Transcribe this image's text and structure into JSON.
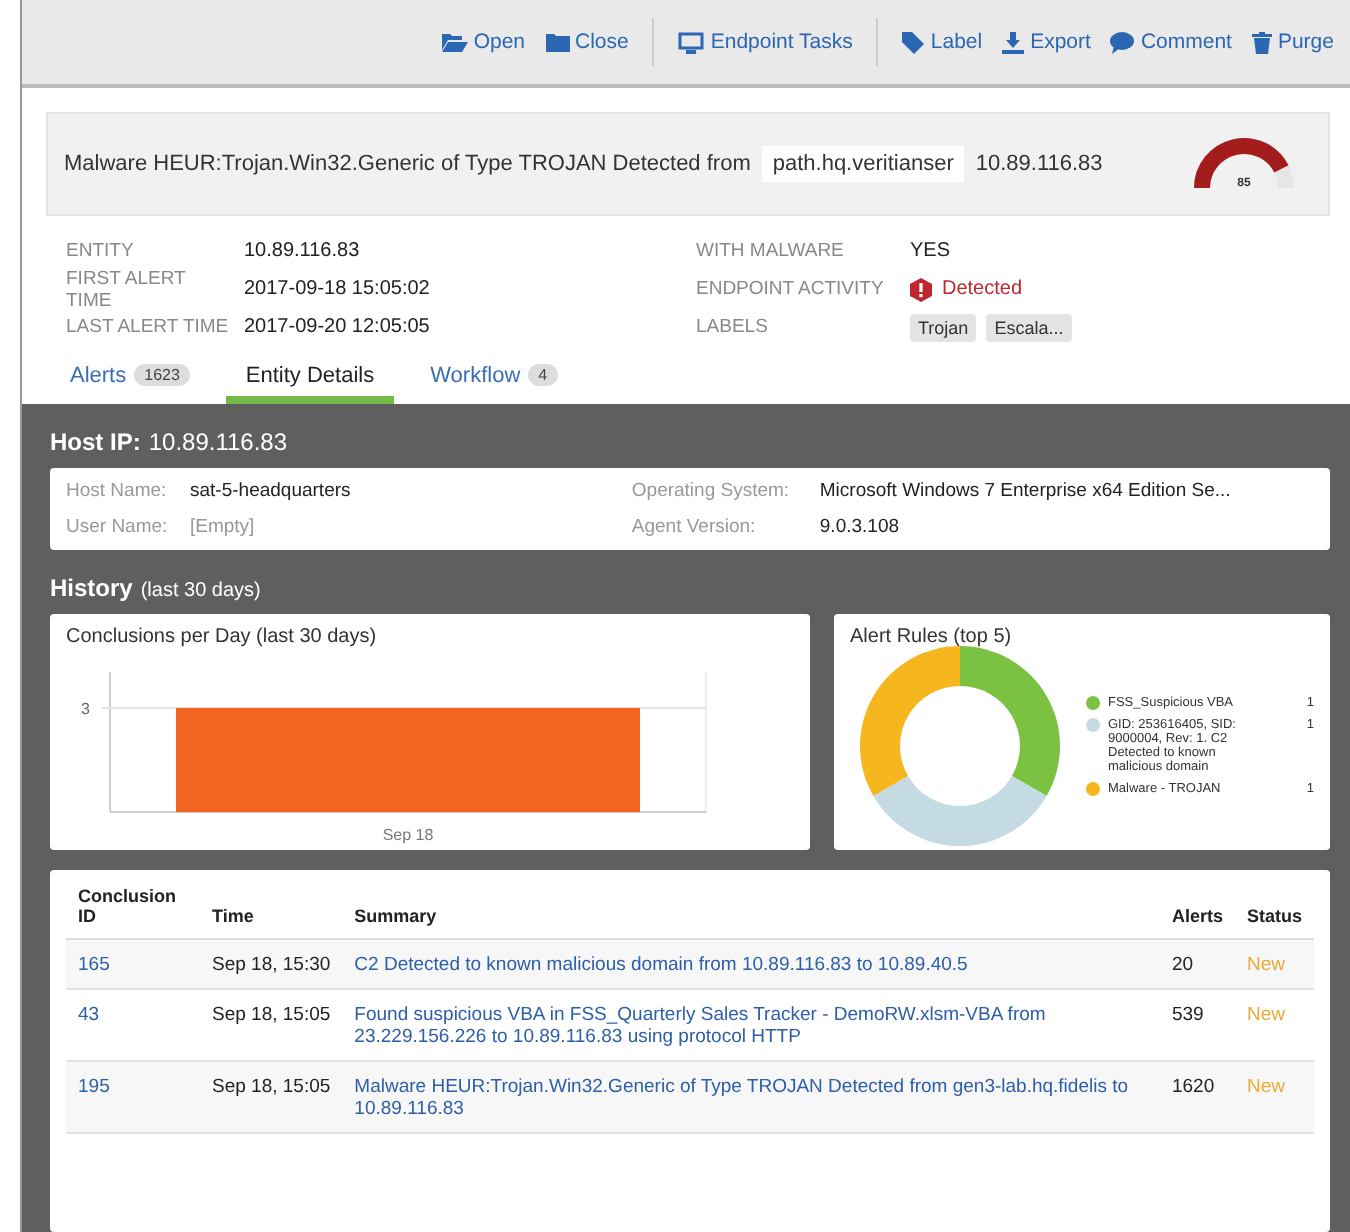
{
  "toolbar": {
    "buttons": [
      {
        "label": "Open"
      },
      {
        "label": "Close"
      },
      {
        "label": "Endpoint Tasks"
      },
      {
        "label": "Label"
      },
      {
        "label": "Export"
      },
      {
        "label": "Comment"
      },
      {
        "label": "Purge"
      }
    ]
  },
  "alert": {
    "title": "Malware HEUR:Trojan.Win32.Generic of Type TROJAN Detected from",
    "host": "path.hq.veritianser",
    "ip": "10.89.116.83",
    "score": {
      "reading": "85"
    }
  },
  "details_left": [
    {
      "label": "ENTITY",
      "value": "10.89.116.83"
    },
    {
      "label": "FIRST ALERT TIME",
      "value": "2017-09-18 15:05:02"
    },
    {
      "label": "LAST ALERT TIME",
      "value": "2017-09-20 12:05:05"
    }
  ],
  "details_right": [
    {
      "label": "WITH MALWARE",
      "kind": "text",
      "value": "YES"
    },
    {
      "label": "ENDPOINT ACTIVITY",
      "kind": "alert",
      "value": "Detected"
    },
    {
      "label": "LABELS",
      "kind": "tags",
      "tags": [
        "Trojan",
        "Escala..."
      ]
    }
  ],
  "tabs": [
    {
      "label": "Alerts",
      "count": "1623",
      "selected": false
    },
    {
      "label": "Entity Details",
      "selected": true
    },
    {
      "label": "Workflow",
      "count": "4",
      "selected": false
    }
  ],
  "host": {
    "heading": "Host IP:",
    "ip": "10.89.116.83",
    "left": [
      {
        "label": "Host Name:",
        "value": "sat-5-headquarters"
      },
      {
        "label": "User Name:",
        "value": "[Empty]"
      }
    ],
    "right": [
      {
        "label": "Operating System:",
        "value": "Microsoft Windows 7 Enterprise x64 Edition Se..."
      },
      {
        "label": "Agent Version:",
        "value": "9.0.3.108"
      }
    ]
  },
  "history": {
    "heading": "History",
    "note": "(last 30 days)"
  },
  "conclusions_chart": {
    "title": "Conclusions per Day (last 30 days)",
    "y_tick": "3",
    "x_label": "Sep 18"
  },
  "alert_rules": {
    "title": "Alert Rules (top 5)",
    "chart_data": {
      "type": "donut",
      "categories": [
        "FSS_Suspicious VBA",
        "GID: 253616405, SID: 9000004, Rev: 1. C2 Detected to known malicious domain",
        "Malware - TROJAN"
      ],
      "values": [
        1,
        1,
        1
      ],
      "legend": "right"
    },
    "legend": [
      {
        "count": "1",
        "color": "#7cc242"
      },
      {
        "count": "1",
        "color": "#c5dbe3"
      },
      {
        "count": "1",
        "color": "#f5b71d"
      }
    ]
  },
  "table": {
    "columns": [
      "Conclusion ID",
      "Time",
      "Summary",
      "Alerts",
      "Status"
    ],
    "rows": [
      {
        "id": "165",
        "time": "Sep 18, 15:30",
        "summary": "C2 Detected to known malicious domain from 10.89.116.83 to 10.89.40.5",
        "alerts": "20",
        "status": "New"
      },
      {
        "id": "43",
        "time": "Sep 18, 15:05",
        "summary": "Found suspicious VBA in FSS_Quarterly Sales Tracker - DemoRW.xlsm-VBA from 23.229.156.226 to 10.89.116.83 using protocol HTTP",
        "alerts": "539",
        "status": "New"
      },
      {
        "id": "195",
        "time": "Sep 18, 15:05",
        "summary": "Malware HEUR:Trojan.Win32.Generic of Type TROJAN Detected from gen3-lab.hq.fidelis to 10.89.116.83",
        "alerts": "1620",
        "status": "New"
      }
    ]
  }
}
